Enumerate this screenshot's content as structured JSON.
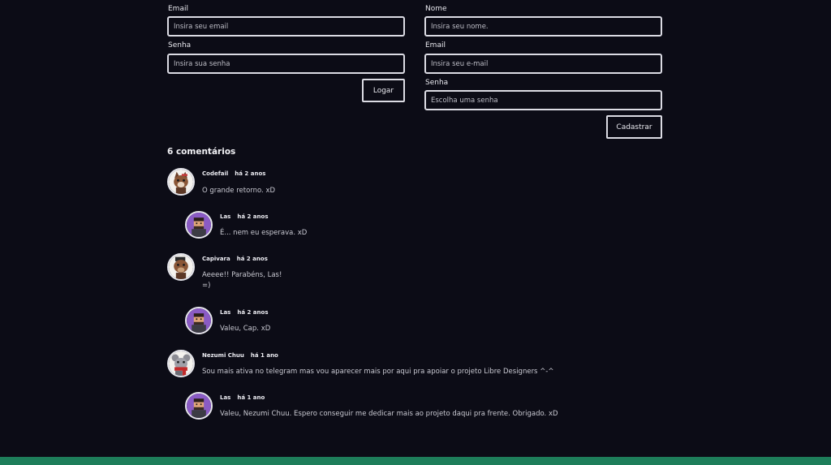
{
  "login": {
    "email_label": "Email",
    "email_placeholder": "Insira seu email",
    "password_label": "Senha",
    "password_placeholder": "Insira sua senha",
    "submit_label": "Logar"
  },
  "register": {
    "name_label": "Nome",
    "name_placeholder": "Insira seu nome.",
    "email_label": "Email",
    "email_placeholder": "Insira seu e-mail",
    "password_label": "Senha",
    "password_placeholder": "Escolha uma senha",
    "submit_label": "Cadastrar"
  },
  "comments": {
    "heading": "6 comentários",
    "items": [
      {
        "author": "Codefail",
        "time": "há 2 anos",
        "text": "O grande retorno. xD",
        "avatar": "fox-character"
      },
      {
        "author": "Las",
        "time": "há 2 anos",
        "text": "É... nem eu esperava. xD",
        "avatar": "pixel-man"
      },
      {
        "author": "Capivara",
        "time": "há 2 anos",
        "text": "Aeeee!! Parabéns, Las!",
        "text2": "=)",
        "avatar": "capybara-character"
      },
      {
        "author": "Las",
        "time": "há 2 anos",
        "text": "Valeu, Cap. xD",
        "avatar": "pixel-man"
      },
      {
        "author": "Nezumi Chuu",
        "time": "há 1 ano",
        "text": "Sou mais ativa no telegram mas vou aparecer mais por aqui pra apoiar o projeto Libre Designers ^-^",
        "avatar": "mouse-character"
      },
      {
        "author": "Las",
        "time": "há 1 ano",
        "text": "Valeu, Nezumi Chuu. Espero conseguir me dedicar mais ao projeto daqui pra frente. Obrigado. xD",
        "avatar": "pixel-man"
      }
    ]
  },
  "colors": {
    "background": "#0c0c16",
    "footer_accent": "#1e7e5a",
    "avatar_reply_bg": "#8a5bc4"
  }
}
